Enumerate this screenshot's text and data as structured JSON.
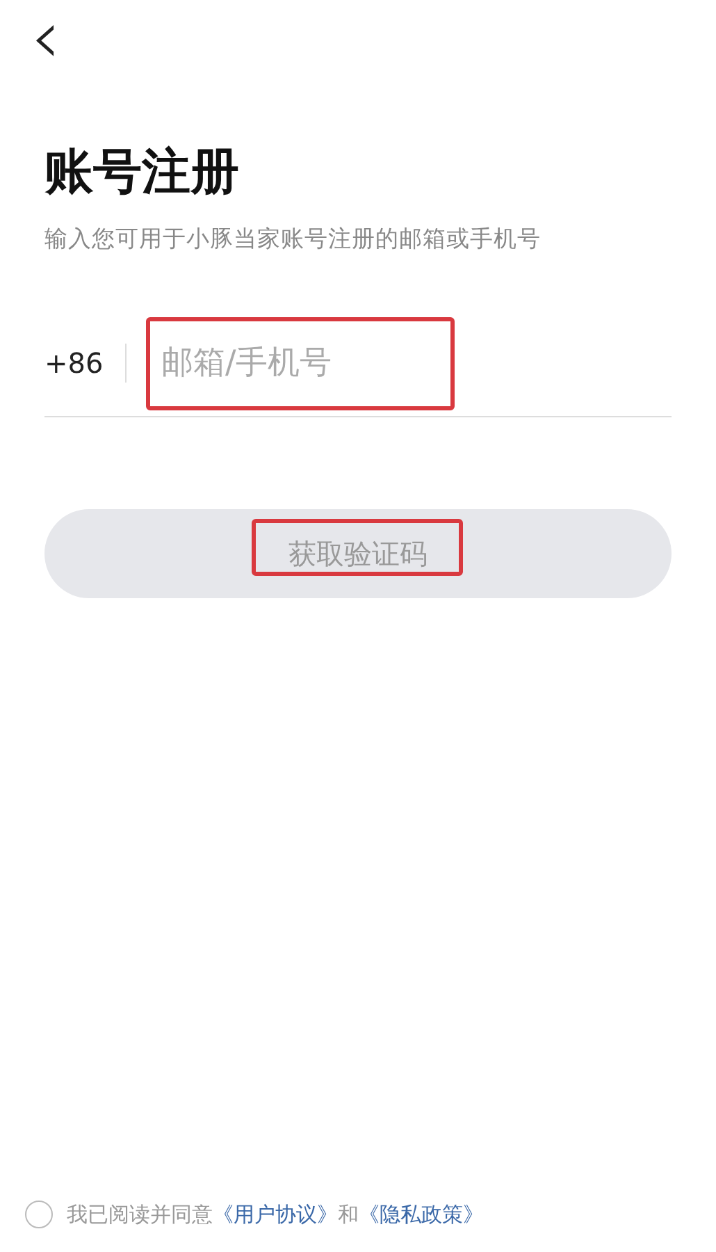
{
  "back_button": {
    "label": "‹"
  },
  "title": "账号注册",
  "subtitle": "输入您可用于小豚当家账号注册的邮箱或手机号",
  "phone_field": {
    "country_code": "+86",
    "placeholder": "邮箱/手机号",
    "highlighted": true
  },
  "submit_button": {
    "label": "获取验证码",
    "disabled": true,
    "highlighted": true
  },
  "agreement": {
    "checked": false,
    "parts": [
      {
        "kind": "text",
        "text": "我已阅读并同意"
      },
      {
        "kind": "link",
        "text": "《用户协议》"
      },
      {
        "kind": "text",
        "text": "和"
      },
      {
        "kind": "link",
        "text": "《隐私政策》"
      }
    ]
  }
}
